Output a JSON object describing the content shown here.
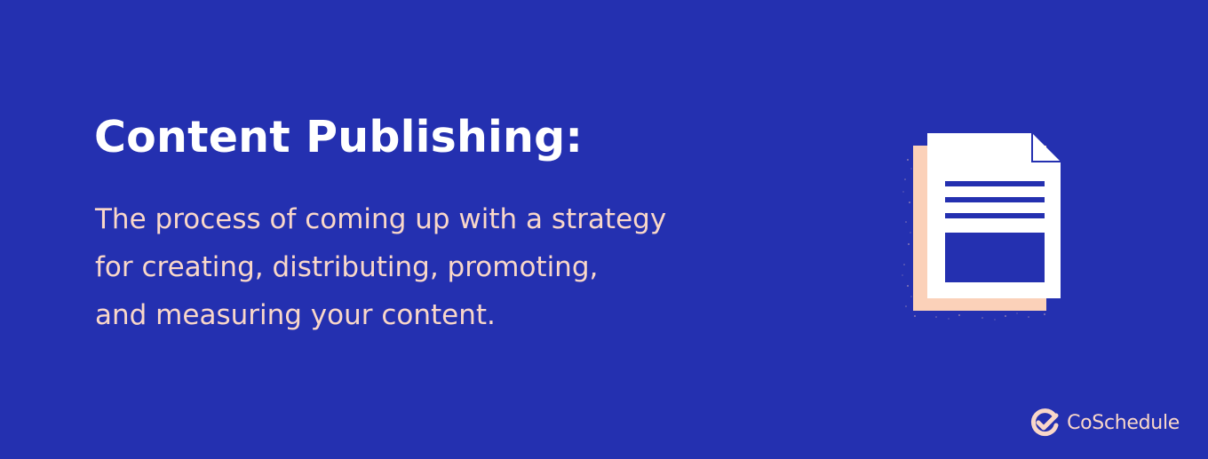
{
  "colors": {
    "background": "#2430b0",
    "title": "#ffffff",
    "text": "#f9d7c9",
    "document_shadow": "#fbd1b9",
    "document": "#ffffff",
    "document_lines": "#2430b0"
  },
  "heading": {
    "title": "Content Publishing:"
  },
  "definition": {
    "lines": [
      "The process of coming up with a strategy",
      "for creating, distributing, promoting,",
      "and measuring your content."
    ]
  },
  "illustration": {
    "icon": "document-icon"
  },
  "brand": {
    "logo_icon": "coschedule-check-icon",
    "name": "CoSchedule"
  }
}
